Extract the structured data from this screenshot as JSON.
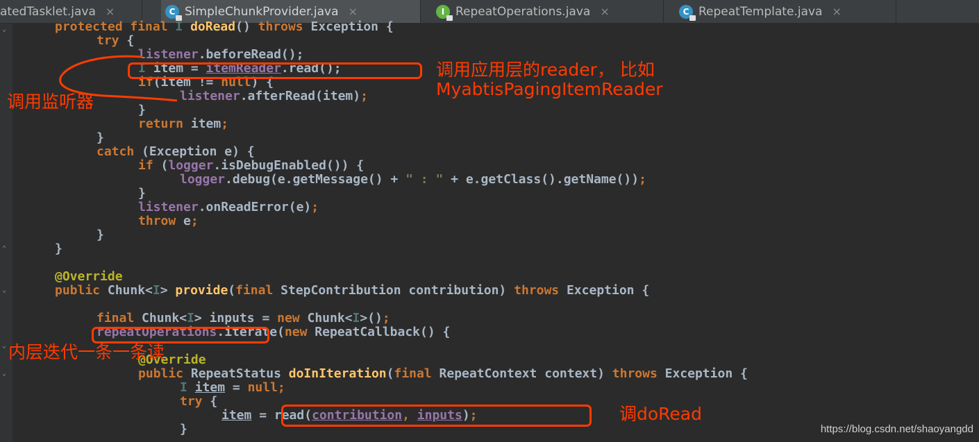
{
  "tabs": [
    {
      "label": "atedTasklet.java",
      "icon": "",
      "active": false
    },
    {
      "label": "SimpleChunkProvider.java",
      "icon": "class-icon",
      "active": true
    },
    {
      "label": "RepeatOperations.java",
      "icon": "interface-icon",
      "active": false
    },
    {
      "label": "RepeatTemplate.java",
      "icon": "class-icon",
      "active": false
    }
  ],
  "tab_close_glyph": "×",
  "code_lines": [
    "protected final I doRead() throws Exception {",
    "try {",
    "listener.beforeRead();",
    "I item = itemReader.read();",
    "if(item != null) {",
    "listener.afterRead(item);",
    "}",
    "return item;",
    "}",
    "catch (Exception e) {",
    "if (logger.isDebugEnabled()) {",
    "logger.debug(e.getMessage() + \" : \" + e.getClass().getName());",
    "}",
    "listener.onReadError(e);",
    "throw e;",
    "}",
    "}",
    "",
    "@Override",
    "public Chunk<I> provide(final StepContribution contribution) throws Exception {",
    "",
    "final Chunk<I> inputs = new Chunk<I>();",
    "repeatOperations.iterate(new RepeatCallback() {",
    "",
    "@Override",
    "public RepeatStatus doInIteration(final RepeatContext context) throws Exception {",
    "I item = null;",
    "try {",
    "item = read(contribution, inputs);",
    "}"
  ],
  "annotations": {
    "call_reader": "调用应用层的reader， 比如",
    "call_reader_example": "MyabtisPagingItemReader",
    "call_listener": "调用监听器",
    "inner_iterate": "内层迭代一条一条读",
    "call_doread": "调doRead"
  },
  "watermark": "https://blog.csdn.net/shaoyangdd",
  "colors": {
    "background": "#2b2b2b",
    "keyword": "#cc7832",
    "method": "#ffc66d",
    "field": "#9876aa",
    "annotation": "#bbb529",
    "highlight": "#ff3c00"
  }
}
